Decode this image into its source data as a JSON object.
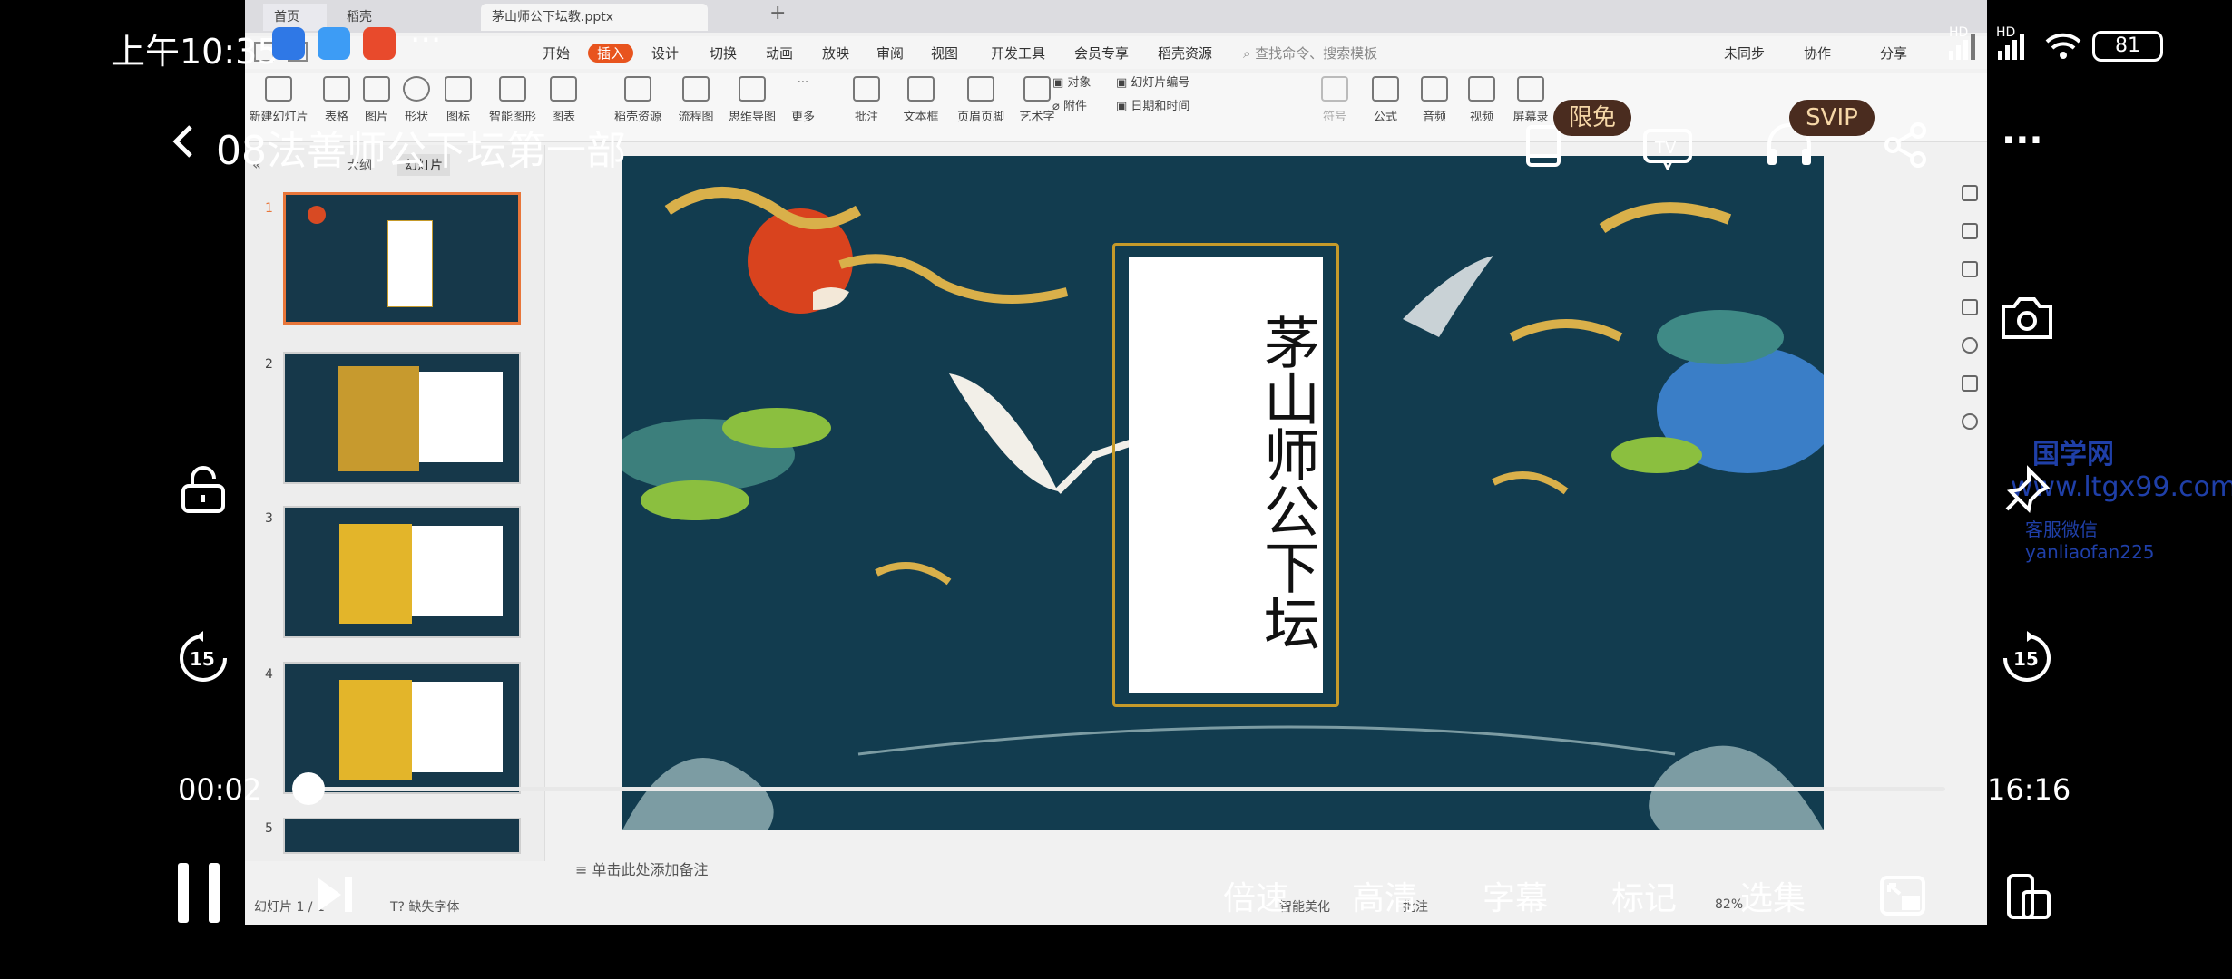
{
  "status_bar": {
    "time": "上午10:35",
    "dots": "···",
    "net_hd1": "HD",
    "net_hd2": "HD",
    "battery": "81"
  },
  "header": {
    "back_icon": "chevron-left-icon",
    "title": "08法善师公下坛第一部",
    "badge_free": "限免",
    "badge_svip": "SVIP"
  },
  "recorded_screen": {
    "tabs": [
      "首页",
      "稻壳",
      "茅山师公下坛教.pptx"
    ],
    "menu": [
      "开始",
      "插入",
      "设计",
      "切换",
      "动画",
      "放映",
      "审阅",
      "视图",
      "开发工具",
      "会员专享",
      "稻壳资源"
    ],
    "menu_active": "插入",
    "search_placeholder": "查找命令、搜索模板",
    "top_right": [
      "未同步",
      "协作",
      "分享"
    ],
    "tools": [
      "新建幻灯片",
      "表格",
      "图片",
      "形状",
      "图标",
      "智能图形",
      "图表",
      "稻壳资源",
      "流程图",
      "思维导图",
      "更多",
      "批注",
      "文本框",
      "页眉页脚",
      "艺术字",
      "附件",
      "日期和时间",
      "符号",
      "公式",
      "音频",
      "视频",
      "屏幕录"
    ],
    "tools_inline": [
      "对象",
      "幻灯片编号"
    ],
    "panel_tabs": [
      "大纲",
      "幻灯片"
    ],
    "slide_numbers": [
      "1",
      "2",
      "3",
      "4",
      "5"
    ],
    "slide_title": "茅山师公下坛",
    "notes_placeholder": "单击此处添加备注",
    "status_left": "幻灯片 1 / 1",
    "status_font": "缺失字体",
    "status_beautify": "智能美化",
    "status_comment": "批注",
    "zoom": "82%"
  },
  "watermark": {
    "line1": "国学网",
    "line2": "www.ltgx99.com",
    "line3": "客服微信 yanliaofan225"
  },
  "player": {
    "current_time": "00:02",
    "duration": "16:16",
    "progress": 0.002,
    "bottom_labels": [
      "倍速",
      "高清",
      "字幕",
      "标记",
      "选集"
    ],
    "replay_label": "15",
    "forward_label": "15"
  }
}
